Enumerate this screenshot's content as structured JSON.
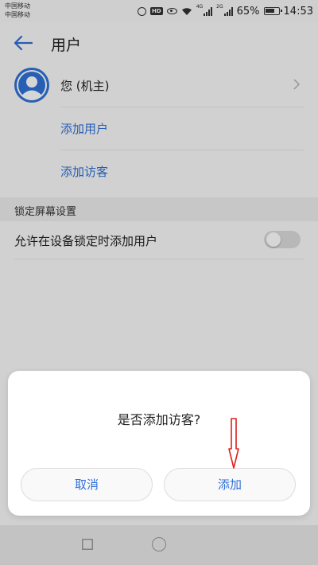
{
  "status_bar": {
    "carrier1": "中国移动",
    "carrier2": "中国移动",
    "network1": "4G",
    "network2": "2G",
    "battery": "65%",
    "time": "14:53"
  },
  "header": {
    "title": "用户"
  },
  "users": {
    "owner_label": "您 (机主)",
    "add_user": "添加用户",
    "add_guest": "添加访客"
  },
  "lock_screen": {
    "section_title": "锁定屏幕设置",
    "allow_add_users_label": "允许在设备锁定时添加用户",
    "allow_add_users_enabled": false
  },
  "dialog": {
    "message": "是否添加访客?",
    "cancel_label": "取消",
    "confirm_label": "添加"
  },
  "colors": {
    "accent": "#2f6fd6",
    "annotation": "#e0201a"
  }
}
